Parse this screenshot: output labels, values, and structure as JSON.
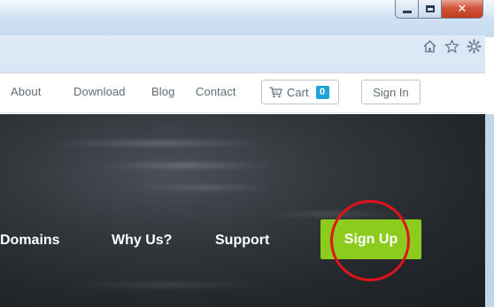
{
  "window": {
    "buttons": {
      "minimize_icon": "minimize-icon",
      "maximize_icon": "maximize-icon",
      "close_glyph": "✕"
    }
  },
  "browser_toolbar": {
    "icons": [
      "home-icon",
      "star-icon",
      "gear-icon"
    ]
  },
  "site_nav": {
    "links": [
      "About",
      "Download",
      "Blog",
      "Contact"
    ],
    "cart": {
      "label": "Cart",
      "count": "0",
      "icon": "cart-icon"
    },
    "sign_in": "Sign In"
  },
  "hero": {
    "menu": [
      "Domains",
      "Why Us?",
      "Support"
    ],
    "cta": "Sign Up",
    "colors": {
      "cta": "#8ccc1d",
      "highlight_circle": "#e0131a",
      "badge": "#1ea3d9"
    }
  }
}
